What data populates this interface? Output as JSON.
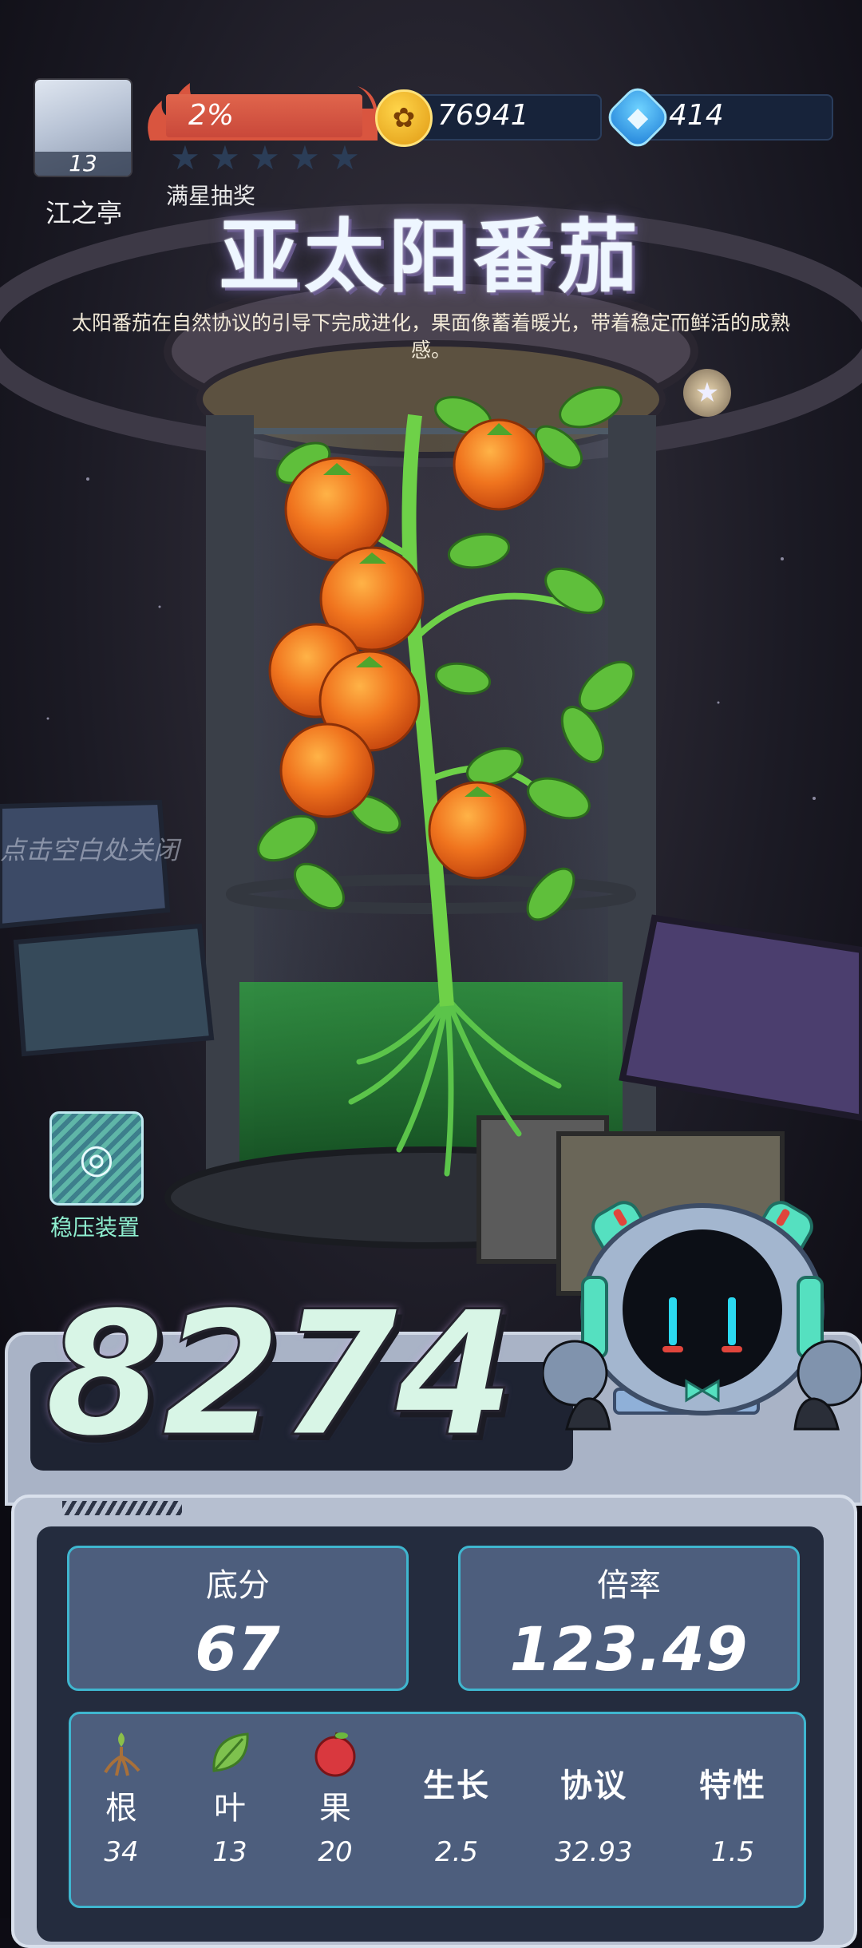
{
  "player": {
    "name": "江之亭",
    "level": "13"
  },
  "fire": {
    "percent_text": "2%",
    "percent": 0.02
  },
  "stars": {
    "label": "满星抽奖",
    "filled": 0,
    "total": 5
  },
  "resources": {
    "coins": "76941",
    "gems": "414"
  },
  "plant": {
    "title": "亚太阳番茄",
    "description": "太阳番茄在自然协议的引导下完成进化，果面像蓄着暖光，带着稳定而鲜活的成熟感。"
  },
  "close_hint": "点击空白处关闭",
  "stabilizer": {
    "label": "稳压装置"
  },
  "score": "8274",
  "stats": {
    "base": {
      "label": "底分",
      "value": "67"
    },
    "multiplier": {
      "label": "倍率",
      "value": "123.49"
    }
  },
  "attributes": [
    {
      "label": "根",
      "value": "34",
      "icon": "root-icon"
    },
    {
      "label": "叶",
      "value": "13",
      "icon": "leaf-icon"
    },
    {
      "label": "果",
      "value": "20",
      "icon": "fruit-icon"
    },
    {
      "label": "生长",
      "value": "2.5"
    },
    {
      "label": "协议",
      "value": "32.93"
    },
    {
      "label": "特性",
      "value": "1.5"
    }
  ],
  "colors": {
    "accent": "#3fb6cf",
    "fire": "#d9553f",
    "card": "#4d5e7d"
  }
}
